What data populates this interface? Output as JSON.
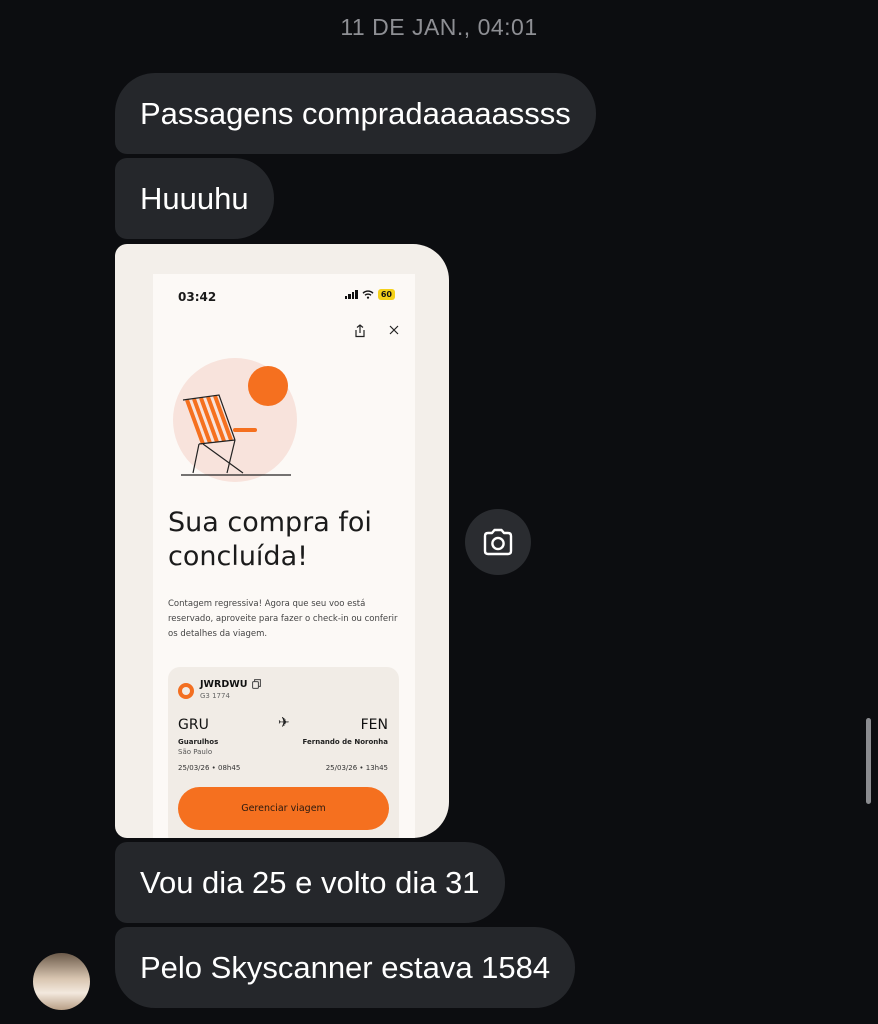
{
  "timestamp": "11 DE JAN., 04:01",
  "messages": [
    {
      "text": "Passagens compradaaaaassss"
    },
    {
      "text": "Huuuhu"
    },
    {
      "text": "Vou dia 25 e volto dia 31"
    },
    {
      "text": "Pelo Skyscanner estava 1584"
    }
  ],
  "screenshot": {
    "status_time": "03:42",
    "battery": "60",
    "headline_line1": "Sua compra foi",
    "headline_line2": "concluída!",
    "description": "Contagem regressiva! Agora que seu voo está reservado, aproveite para fazer o check-in ou conferir os detalhes da viagem.",
    "booking": {
      "code": "JWRDWU",
      "flight": "G3 1774",
      "origin": {
        "iata": "GRU",
        "city": "Guarulhos",
        "state": "São Paulo",
        "datetime": "25/03/26 • 08h45"
      },
      "destination": {
        "iata": "FEN",
        "city": "Fernando de Noronha",
        "datetime": "25/03/26 • 13h45"
      }
    },
    "manage_button": "Gerenciar viagem",
    "accent_color": "#f5701f"
  },
  "icons": {
    "share": "share-icon",
    "close": "close-icon",
    "camera": "camera-icon",
    "copy": "copy-icon",
    "plane": "airplane-icon"
  }
}
